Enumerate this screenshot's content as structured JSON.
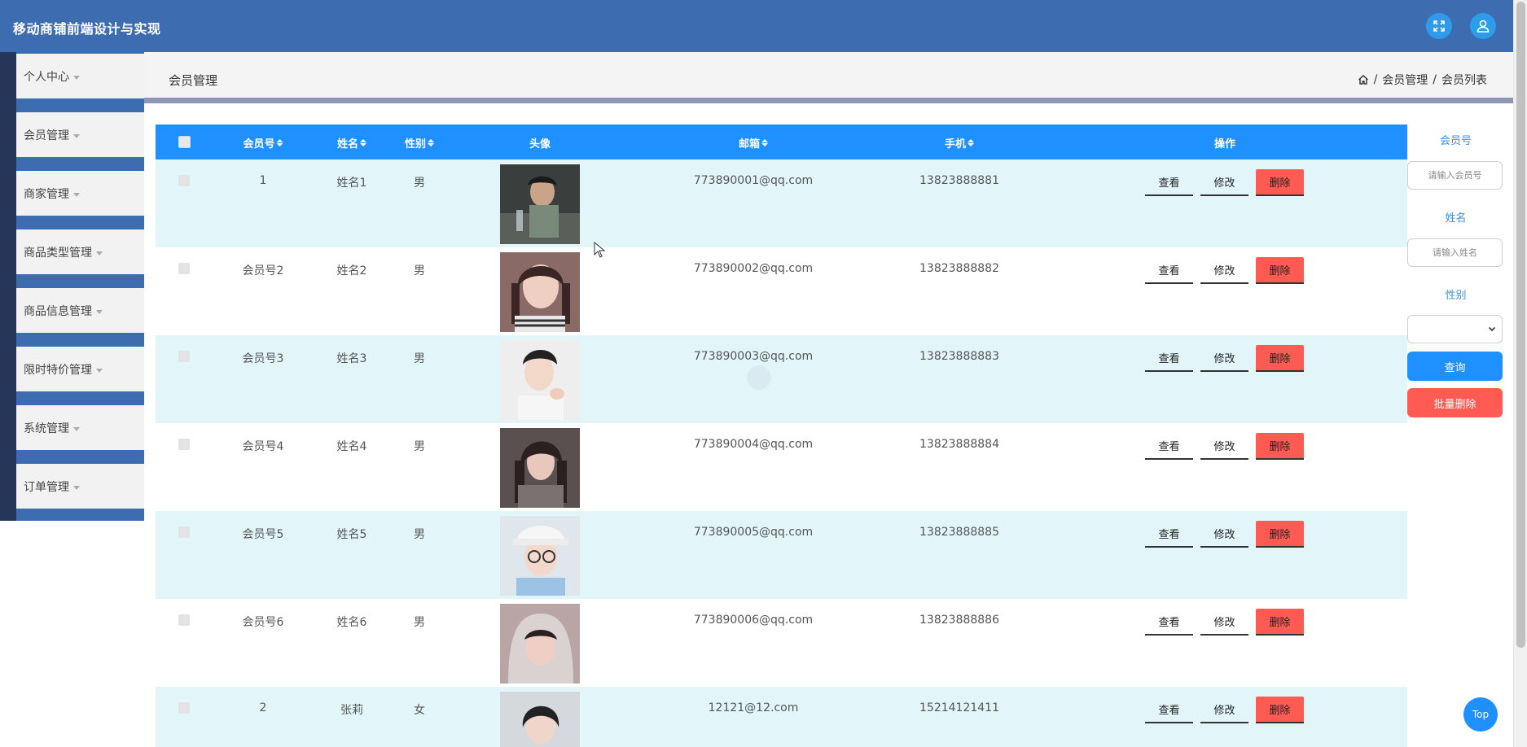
{
  "app": {
    "title": "移动商铺前端设计与实现"
  },
  "header": {
    "fullscreen_icon": "expand-icon",
    "user_icon": "user-icon"
  },
  "sidebar": {
    "items": [
      {
        "label": "个人中心"
      },
      {
        "label": "会员管理"
      },
      {
        "label": "商家管理"
      },
      {
        "label": "商品类型管理"
      },
      {
        "label": "商品信息管理"
      },
      {
        "label": "限时特价管理"
      },
      {
        "label": "系统管理"
      },
      {
        "label": "订单管理"
      }
    ]
  },
  "page": {
    "title": "会员管理",
    "breadcrumb": [
      "会员管理",
      "会员列表"
    ],
    "breadcrumb_separator": "/"
  },
  "table": {
    "columns": {
      "member_no": "会员号",
      "name": "姓名",
      "gender": "性别",
      "avatar": "头像",
      "email": "邮箱",
      "phone": "手机",
      "actions": "操作"
    },
    "actions": {
      "view": "查看",
      "edit": "修改",
      "delete": "删除"
    },
    "rows": [
      {
        "member_no": "1",
        "name": "姓名1",
        "gender": "男",
        "email": "773890001@qq.com",
        "phone": "13823888881"
      },
      {
        "member_no": "会员号2",
        "name": "姓名2",
        "gender": "男",
        "email": "773890002@qq.com",
        "phone": "13823888882"
      },
      {
        "member_no": "会员号3",
        "name": "姓名3",
        "gender": "男",
        "email": "773890003@qq.com",
        "phone": "13823888883"
      },
      {
        "member_no": "会员号4",
        "name": "姓名4",
        "gender": "男",
        "email": "773890004@qq.com",
        "phone": "13823888884"
      },
      {
        "member_no": "会员号5",
        "name": "姓名5",
        "gender": "男",
        "email": "773890005@qq.com",
        "phone": "13823888885"
      },
      {
        "member_no": "会员号6",
        "name": "姓名6",
        "gender": "男",
        "email": "773890006@qq.com",
        "phone": "13823888886"
      },
      {
        "member_no": "2",
        "name": "张莉",
        "gender": "女",
        "email": "12121@12.com",
        "phone": "15214121411"
      }
    ]
  },
  "search": {
    "member_no_label": "会员号",
    "member_no_placeholder": "请输入会员号",
    "name_label": "姓名",
    "name_placeholder": "请输入姓名",
    "gender_label": "性别",
    "gender_value": "",
    "query_button": "查询",
    "batch_delete_button": "批量删除"
  },
  "back_to_top": "Top",
  "colors": {
    "header": "#3d6db0",
    "table_header": "#1e90ff",
    "row_alt": "#e2f6fa",
    "danger": "#ff5b52",
    "primary": "#1e90ff"
  }
}
